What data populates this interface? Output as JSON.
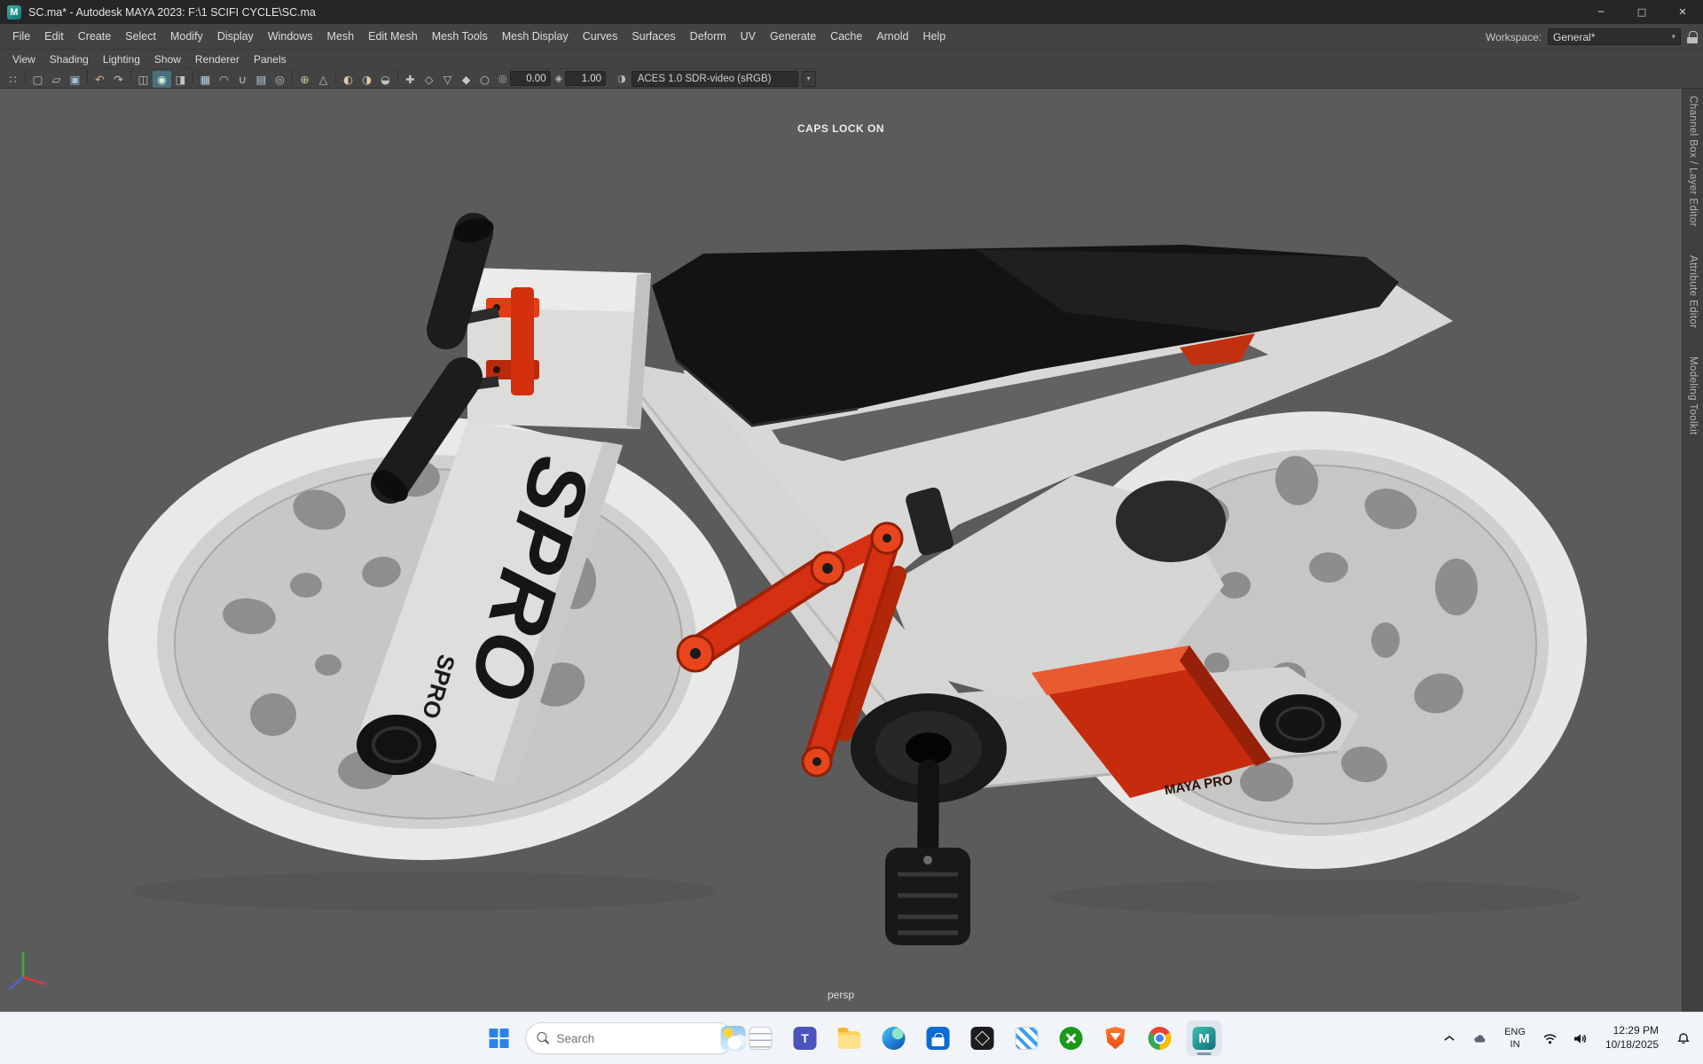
{
  "window": {
    "title": "SC.ma* - Autodesk MAYA 2023: F:\\1 SCIFI CYCLE\\SC.ma",
    "app_icon_letter": "M",
    "minimize": "─",
    "maximize": "□",
    "close": "✕"
  },
  "ui": {
    "arrow": "▾"
  },
  "menubar": {
    "items": [
      "File",
      "Edit",
      "Create",
      "Select",
      "Modify",
      "Display",
      "Windows",
      "Mesh",
      "Edit Mesh",
      "Mesh Tools",
      "Mesh Display",
      "Curves",
      "Surfaces",
      "Deform",
      "UV",
      "Generate",
      "Cache",
      "Arnold",
      "Help"
    ],
    "workspace_label": "Workspace:",
    "workspace_value": "General*"
  },
  "panelbar": {
    "items": [
      "View",
      "Shading",
      "Lighting",
      "Show",
      "Renderer",
      "Panels"
    ]
  },
  "statusline": {
    "icons": [
      {
        "g": "∷",
        "n": "grip-icon"
      },
      {
        "sep": true
      },
      {
        "g": "▢",
        "n": "new-scene-icon"
      },
      {
        "g": "▱",
        "n": "open-scene-icon"
      },
      {
        "g": "▣",
        "n": "save-scene-icon",
        "c": "#9fc3d8"
      },
      {
        "sep": true
      },
      {
        "g": "↶",
        "n": "undo-icon",
        "c": "#cdb97a"
      },
      {
        "g": "↷",
        "n": "redo-icon"
      },
      {
        "sep": true
      },
      {
        "g": "◫",
        "n": "select-hierarchy-icon"
      },
      {
        "g": "◉",
        "n": "select-object-icon",
        "active": true,
        "c": "#d7f0d2"
      },
      {
        "g": "◨",
        "n": "select-component-icon"
      },
      {
        "sep": true
      },
      {
        "g": "▦",
        "n": "snap-grid-icon",
        "c": "#b8cde0"
      },
      {
        "g": "◠",
        "n": "snap-curve-icon",
        "c": "#b8cde0"
      },
      {
        "g": "∪",
        "n": "snap-point-icon",
        "c": "#b8cde0"
      },
      {
        "g": "▤",
        "n": "snap-plane-icon",
        "c": "#b8cde0"
      },
      {
        "g": "◎",
        "n": "snap-view-icon"
      },
      {
        "sep": true
      },
      {
        "g": "⊕",
        "n": "construction-history-icon",
        "c": "#cfc3a0"
      },
      {
        "g": "△",
        "n": "symmetry-icon"
      },
      {
        "sep": true
      },
      {
        "g": "◐",
        "n": "render-icon",
        "c": "#e0c9a8"
      },
      {
        "g": "◑",
        "n": "ipr-render-icon",
        "c": "#e0c9a8"
      },
      {
        "g": "◒",
        "n": "render-settings-icon"
      },
      {
        "sep": true
      },
      {
        "g": "✚",
        "n": "paint-effects-icon"
      },
      {
        "g": "◇",
        "n": "toon-outline-icon"
      },
      {
        "g": "▽",
        "n": "uv-editor-icon"
      },
      {
        "g": "◆",
        "n": "subdiv-icon"
      },
      {
        "g": "○",
        "n": "sphere-primitive-icon"
      }
    ],
    "field1_icon": "◎",
    "field1": "0.00",
    "field2_icon": "◈",
    "field2": "1.00",
    "colorspace_icon": "◑",
    "colorspace": "ACES 1.0 SDR-video (sRGB)"
  },
  "viewport": {
    "hud_caps": "CAPS LOCK ON",
    "camera": "persp",
    "decal_large": "SPRO",
    "decal_small": "SPRO",
    "decal_brand": "MAYA PRO"
  },
  "right_tabs": {
    "channel_box": "Channel Box / Layer Editor",
    "attribute_editor": "Attribute Editor",
    "modeling_toolkit": "Modeling Toolkit"
  },
  "taskbar": {
    "search_placeholder": "Search",
    "teams_letter": "T",
    "maya_letter": "M",
    "lang1": "ENG",
    "lang2": "IN",
    "time": "12:29 PM",
    "date": "10/18/2025",
    "apps": [
      "notepad",
      "teams",
      "file-explorer",
      "edge",
      "store",
      "cube-app",
      "paint",
      "xbox",
      "brave",
      "chrome",
      "maya"
    ]
  }
}
